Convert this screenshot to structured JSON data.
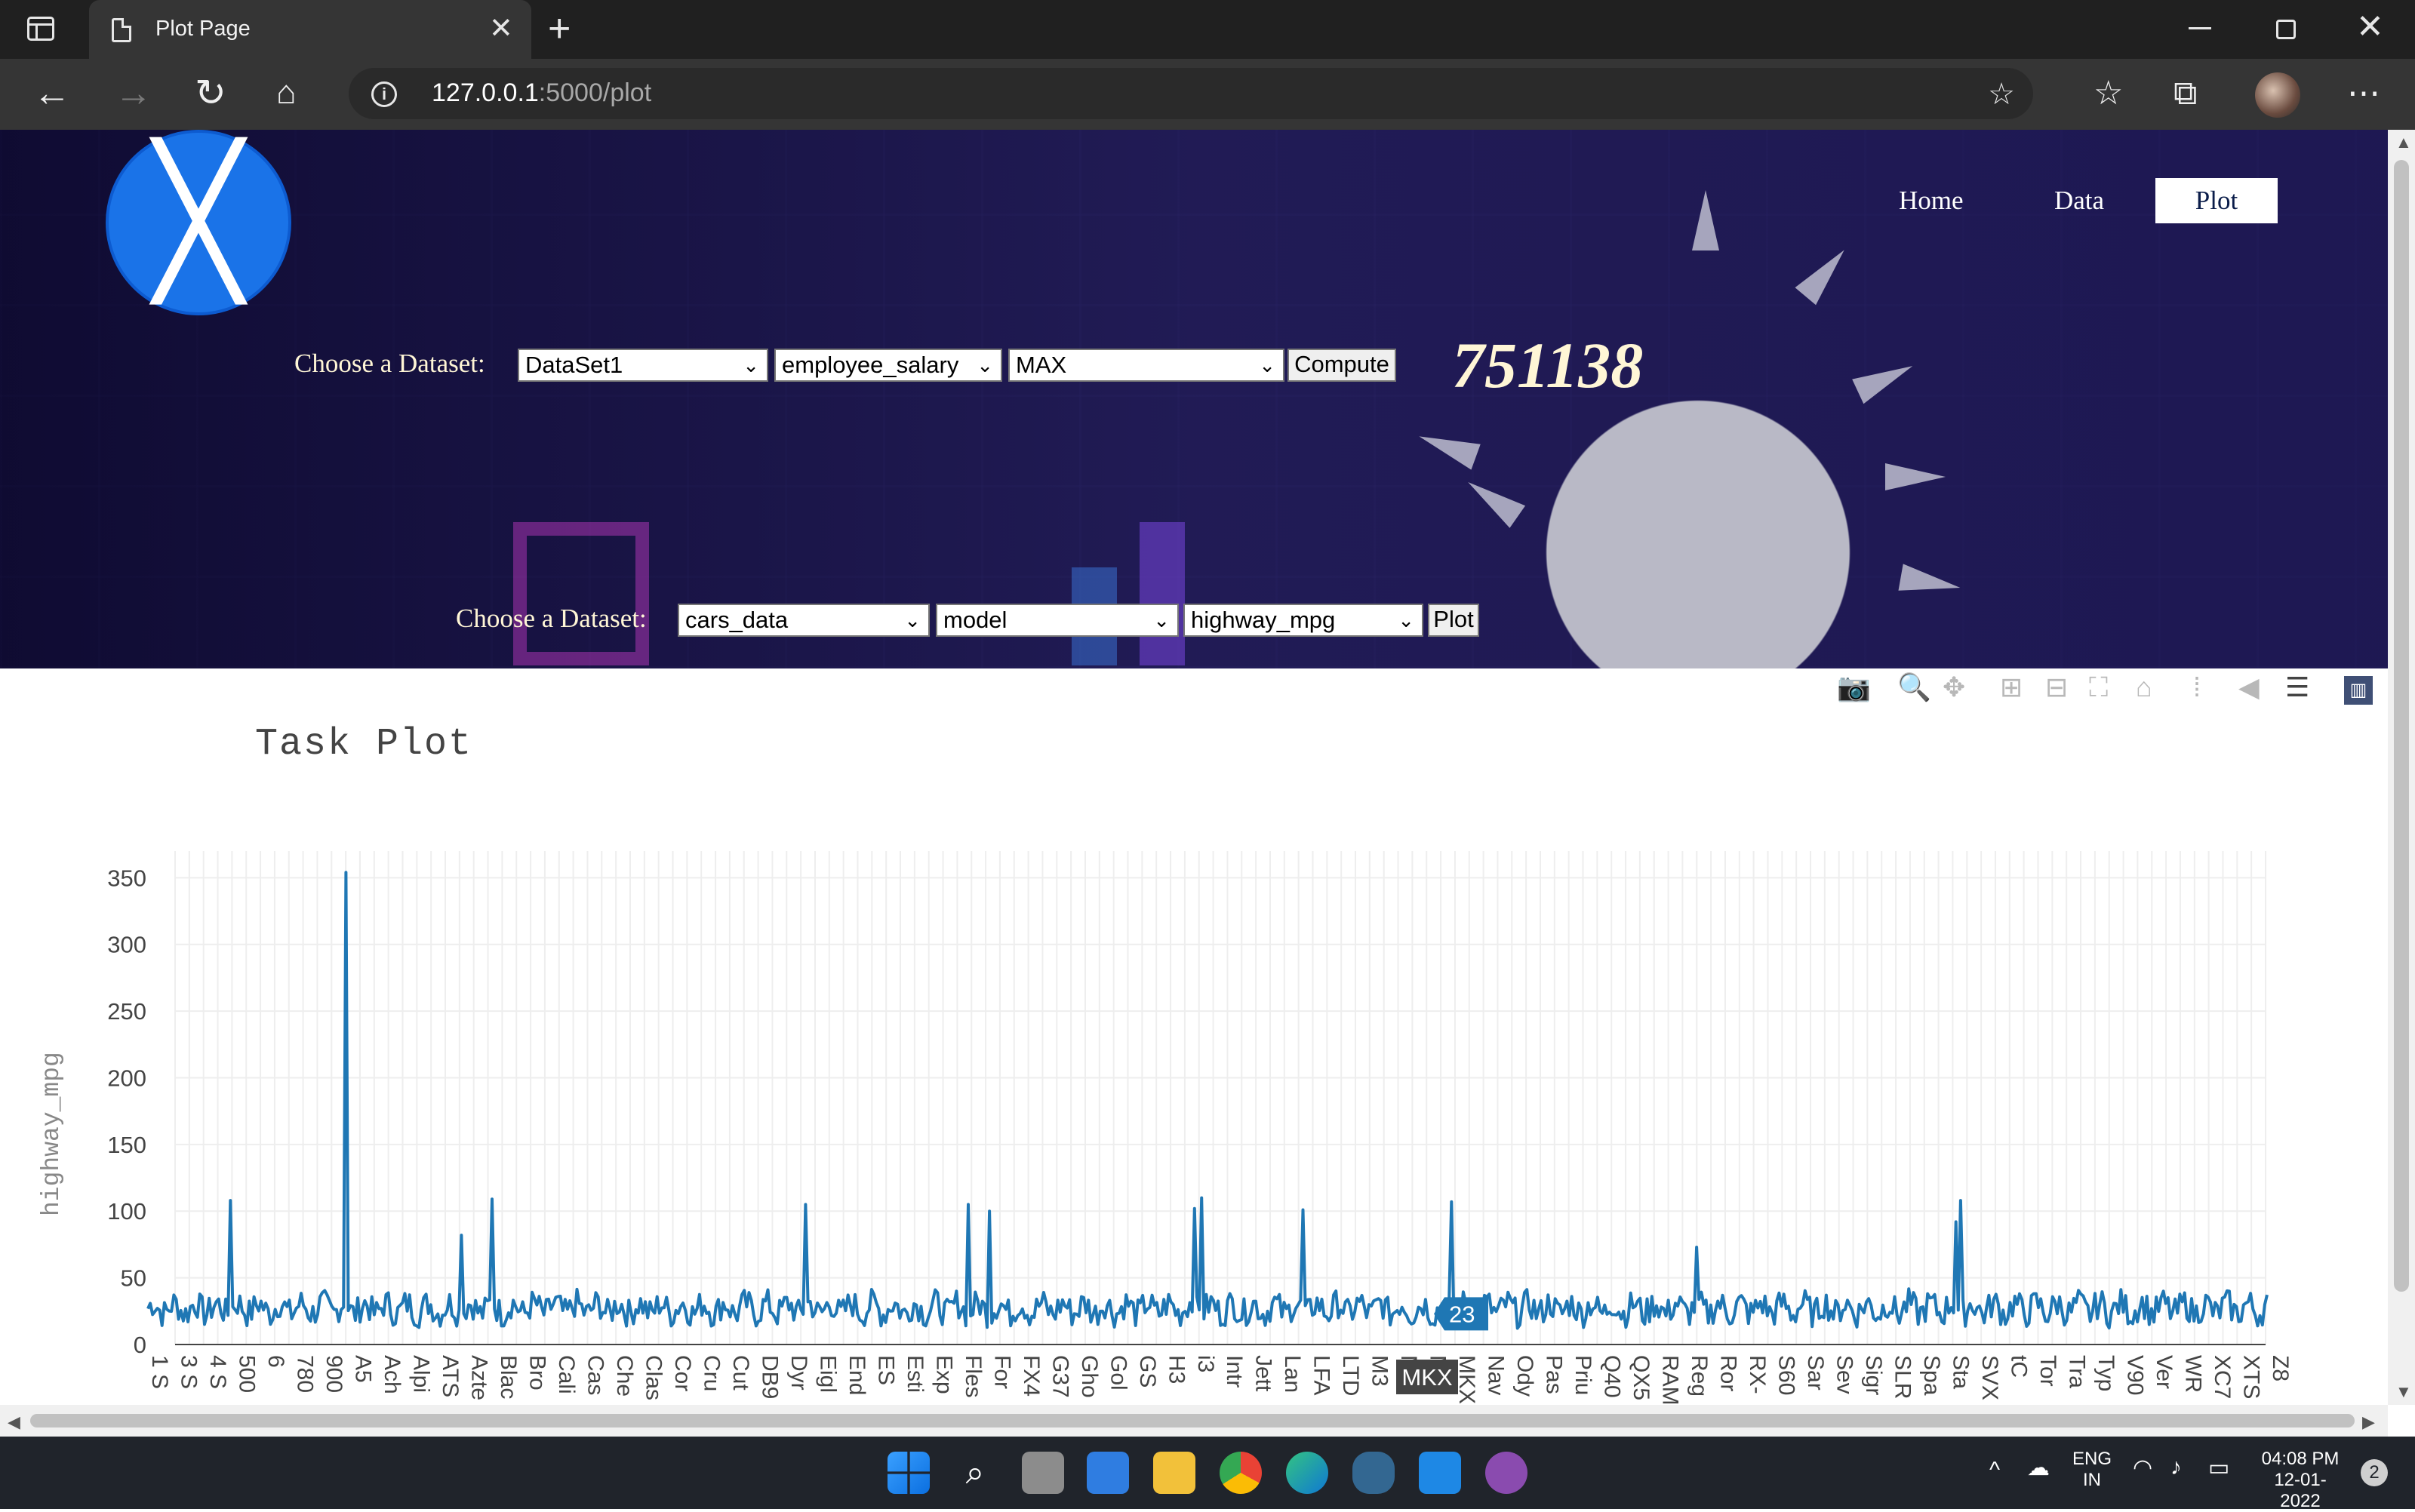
{
  "browser": {
    "tab_title": "Plot Page",
    "url_host": "127.0.0.1",
    "url_rest": ":5000/plot"
  },
  "site": {
    "nav": [
      "Home",
      "Data",
      "Plot"
    ],
    "active_nav": "Plot"
  },
  "compute_form": {
    "label": "Choose a Dataset:",
    "dataset": "DataSet1",
    "column": "employee_salary",
    "operation": "MAX",
    "button": "Compute",
    "result": "751138"
  },
  "plot_form": {
    "label": "Choose a Dataset:",
    "dataset": "cars_data",
    "x_column": "model",
    "y_column": "highway_mpg",
    "button": "Plot"
  },
  "modebar": [
    "camera-icon",
    "zoom-icon",
    "pan-icon",
    "zoom-in-icon",
    "zoom-out-icon",
    "autoscale-icon",
    "reset-axes-icon",
    "spike-lines-icon",
    "hover-closest-icon",
    "hover-compare-icon",
    "plotly-logo-icon"
  ],
  "chart_data": {
    "type": "line",
    "title": "Task Plot",
    "xlabel": "",
    "ylabel": "highway_mpg",
    "ylim": [
      0,
      370
    ],
    "yticks": [
      0,
      50,
      100,
      150,
      200,
      250,
      300,
      350
    ],
    "grid": true,
    "line_color": "#1f77b4",
    "xtick_labels": [
      "1 S",
      "3 S",
      "4 S",
      "500",
      "6",
      "780",
      "900",
      "A5",
      "Ach",
      "Alpi",
      "ATS",
      "Azte",
      "Blac",
      "Bro",
      "Cali",
      "Cas",
      "Che",
      "Clas",
      "Cor",
      "Cru",
      "Cut",
      "DB9",
      "Dyr",
      "Eigl",
      "End",
      "ES",
      "Esti",
      "Exp",
      "Fles",
      "For",
      "FX4",
      "G37",
      "Gho",
      "Gol",
      "GS",
      "H3",
      "i3",
      "Intr",
      "Jett",
      "Lan",
      "LFA",
      "LTD",
      "M3",
      "Mal",
      "Mar",
      "MKX",
      "Nav",
      "Ody",
      "Pas",
      "Priu",
      "Q40",
      "QX5",
      "RAM",
      "Reg",
      "Ror",
      "RX-",
      "S60",
      "Sar",
      "Sev",
      "Sigr",
      "SLR",
      "Spa",
      "Sta",
      "SVX",
      "tC",
      "Tor",
      "Tra",
      "Typ",
      "V90",
      "Ver",
      "WR",
      "XC7",
      "XTS",
      "Z8"
    ],
    "spikes": [
      {
        "x": 0.039,
        "y": 108
      },
      {
        "x": 0.093,
        "y": 354
      },
      {
        "x": 0.148,
        "y": 82
      },
      {
        "x": 0.162,
        "y": 109
      },
      {
        "x": 0.31,
        "y": 105
      },
      {
        "x": 0.387,
        "y": 105
      },
      {
        "x": 0.397,
        "y": 100
      },
      {
        "x": 0.494,
        "y": 102
      },
      {
        "x": 0.497,
        "y": 110
      },
      {
        "x": 0.545,
        "y": 101
      },
      {
        "x": 0.615,
        "y": 107
      },
      {
        "x": 0.731,
        "y": 73
      },
      {
        "x": 0.853,
        "y": 92
      },
      {
        "x": 0.855,
        "y": 108
      }
    ],
    "baseline_mean": 27,
    "hover": {
      "x_label": "MKX",
      "y_value": "23"
    }
  },
  "taskbar": {
    "lang": "ENG",
    "region": "IN",
    "time": "04:08 PM",
    "date": "12-01-2022",
    "notifications": "2"
  }
}
